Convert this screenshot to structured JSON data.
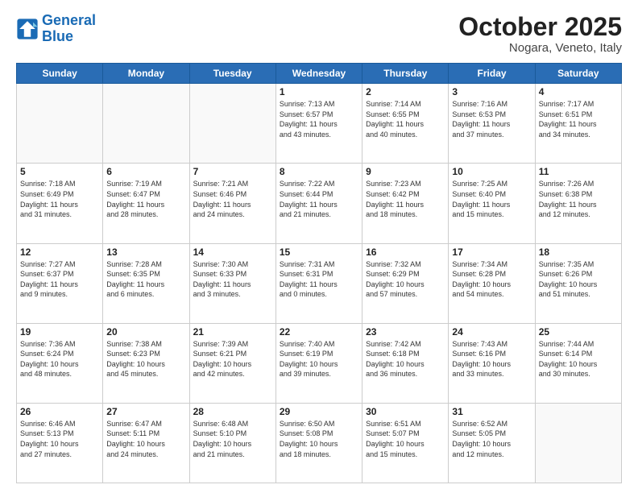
{
  "logo": {
    "line1": "General",
    "line2": "Blue"
  },
  "title": "October 2025",
  "location": "Nogara, Veneto, Italy",
  "weekdays": [
    "Sunday",
    "Monday",
    "Tuesday",
    "Wednesday",
    "Thursday",
    "Friday",
    "Saturday"
  ],
  "weeks": [
    [
      {
        "day": "",
        "info": ""
      },
      {
        "day": "",
        "info": ""
      },
      {
        "day": "",
        "info": ""
      },
      {
        "day": "1",
        "info": "Sunrise: 7:13 AM\nSunset: 6:57 PM\nDaylight: 11 hours\nand 43 minutes."
      },
      {
        "day": "2",
        "info": "Sunrise: 7:14 AM\nSunset: 6:55 PM\nDaylight: 11 hours\nand 40 minutes."
      },
      {
        "day": "3",
        "info": "Sunrise: 7:16 AM\nSunset: 6:53 PM\nDaylight: 11 hours\nand 37 minutes."
      },
      {
        "day": "4",
        "info": "Sunrise: 7:17 AM\nSunset: 6:51 PM\nDaylight: 11 hours\nand 34 minutes."
      }
    ],
    [
      {
        "day": "5",
        "info": "Sunrise: 7:18 AM\nSunset: 6:49 PM\nDaylight: 11 hours\nand 31 minutes."
      },
      {
        "day": "6",
        "info": "Sunrise: 7:19 AM\nSunset: 6:47 PM\nDaylight: 11 hours\nand 28 minutes."
      },
      {
        "day": "7",
        "info": "Sunrise: 7:21 AM\nSunset: 6:46 PM\nDaylight: 11 hours\nand 24 minutes."
      },
      {
        "day": "8",
        "info": "Sunrise: 7:22 AM\nSunset: 6:44 PM\nDaylight: 11 hours\nand 21 minutes."
      },
      {
        "day": "9",
        "info": "Sunrise: 7:23 AM\nSunset: 6:42 PM\nDaylight: 11 hours\nand 18 minutes."
      },
      {
        "day": "10",
        "info": "Sunrise: 7:25 AM\nSunset: 6:40 PM\nDaylight: 11 hours\nand 15 minutes."
      },
      {
        "day": "11",
        "info": "Sunrise: 7:26 AM\nSunset: 6:38 PM\nDaylight: 11 hours\nand 12 minutes."
      }
    ],
    [
      {
        "day": "12",
        "info": "Sunrise: 7:27 AM\nSunset: 6:37 PM\nDaylight: 11 hours\nand 9 minutes."
      },
      {
        "day": "13",
        "info": "Sunrise: 7:28 AM\nSunset: 6:35 PM\nDaylight: 11 hours\nand 6 minutes."
      },
      {
        "day": "14",
        "info": "Sunrise: 7:30 AM\nSunset: 6:33 PM\nDaylight: 11 hours\nand 3 minutes."
      },
      {
        "day": "15",
        "info": "Sunrise: 7:31 AM\nSunset: 6:31 PM\nDaylight: 11 hours\nand 0 minutes."
      },
      {
        "day": "16",
        "info": "Sunrise: 7:32 AM\nSunset: 6:29 PM\nDaylight: 10 hours\nand 57 minutes."
      },
      {
        "day": "17",
        "info": "Sunrise: 7:34 AM\nSunset: 6:28 PM\nDaylight: 10 hours\nand 54 minutes."
      },
      {
        "day": "18",
        "info": "Sunrise: 7:35 AM\nSunset: 6:26 PM\nDaylight: 10 hours\nand 51 minutes."
      }
    ],
    [
      {
        "day": "19",
        "info": "Sunrise: 7:36 AM\nSunset: 6:24 PM\nDaylight: 10 hours\nand 48 minutes."
      },
      {
        "day": "20",
        "info": "Sunrise: 7:38 AM\nSunset: 6:23 PM\nDaylight: 10 hours\nand 45 minutes."
      },
      {
        "day": "21",
        "info": "Sunrise: 7:39 AM\nSunset: 6:21 PM\nDaylight: 10 hours\nand 42 minutes."
      },
      {
        "day": "22",
        "info": "Sunrise: 7:40 AM\nSunset: 6:19 PM\nDaylight: 10 hours\nand 39 minutes."
      },
      {
        "day": "23",
        "info": "Sunrise: 7:42 AM\nSunset: 6:18 PM\nDaylight: 10 hours\nand 36 minutes."
      },
      {
        "day": "24",
        "info": "Sunrise: 7:43 AM\nSunset: 6:16 PM\nDaylight: 10 hours\nand 33 minutes."
      },
      {
        "day": "25",
        "info": "Sunrise: 7:44 AM\nSunset: 6:14 PM\nDaylight: 10 hours\nand 30 minutes."
      }
    ],
    [
      {
        "day": "26",
        "info": "Sunrise: 6:46 AM\nSunset: 5:13 PM\nDaylight: 10 hours\nand 27 minutes."
      },
      {
        "day": "27",
        "info": "Sunrise: 6:47 AM\nSunset: 5:11 PM\nDaylight: 10 hours\nand 24 minutes."
      },
      {
        "day": "28",
        "info": "Sunrise: 6:48 AM\nSunset: 5:10 PM\nDaylight: 10 hours\nand 21 minutes."
      },
      {
        "day": "29",
        "info": "Sunrise: 6:50 AM\nSunset: 5:08 PM\nDaylight: 10 hours\nand 18 minutes."
      },
      {
        "day": "30",
        "info": "Sunrise: 6:51 AM\nSunset: 5:07 PM\nDaylight: 10 hours\nand 15 minutes."
      },
      {
        "day": "31",
        "info": "Sunrise: 6:52 AM\nSunset: 5:05 PM\nDaylight: 10 hours\nand 12 minutes."
      },
      {
        "day": "",
        "info": ""
      }
    ]
  ]
}
